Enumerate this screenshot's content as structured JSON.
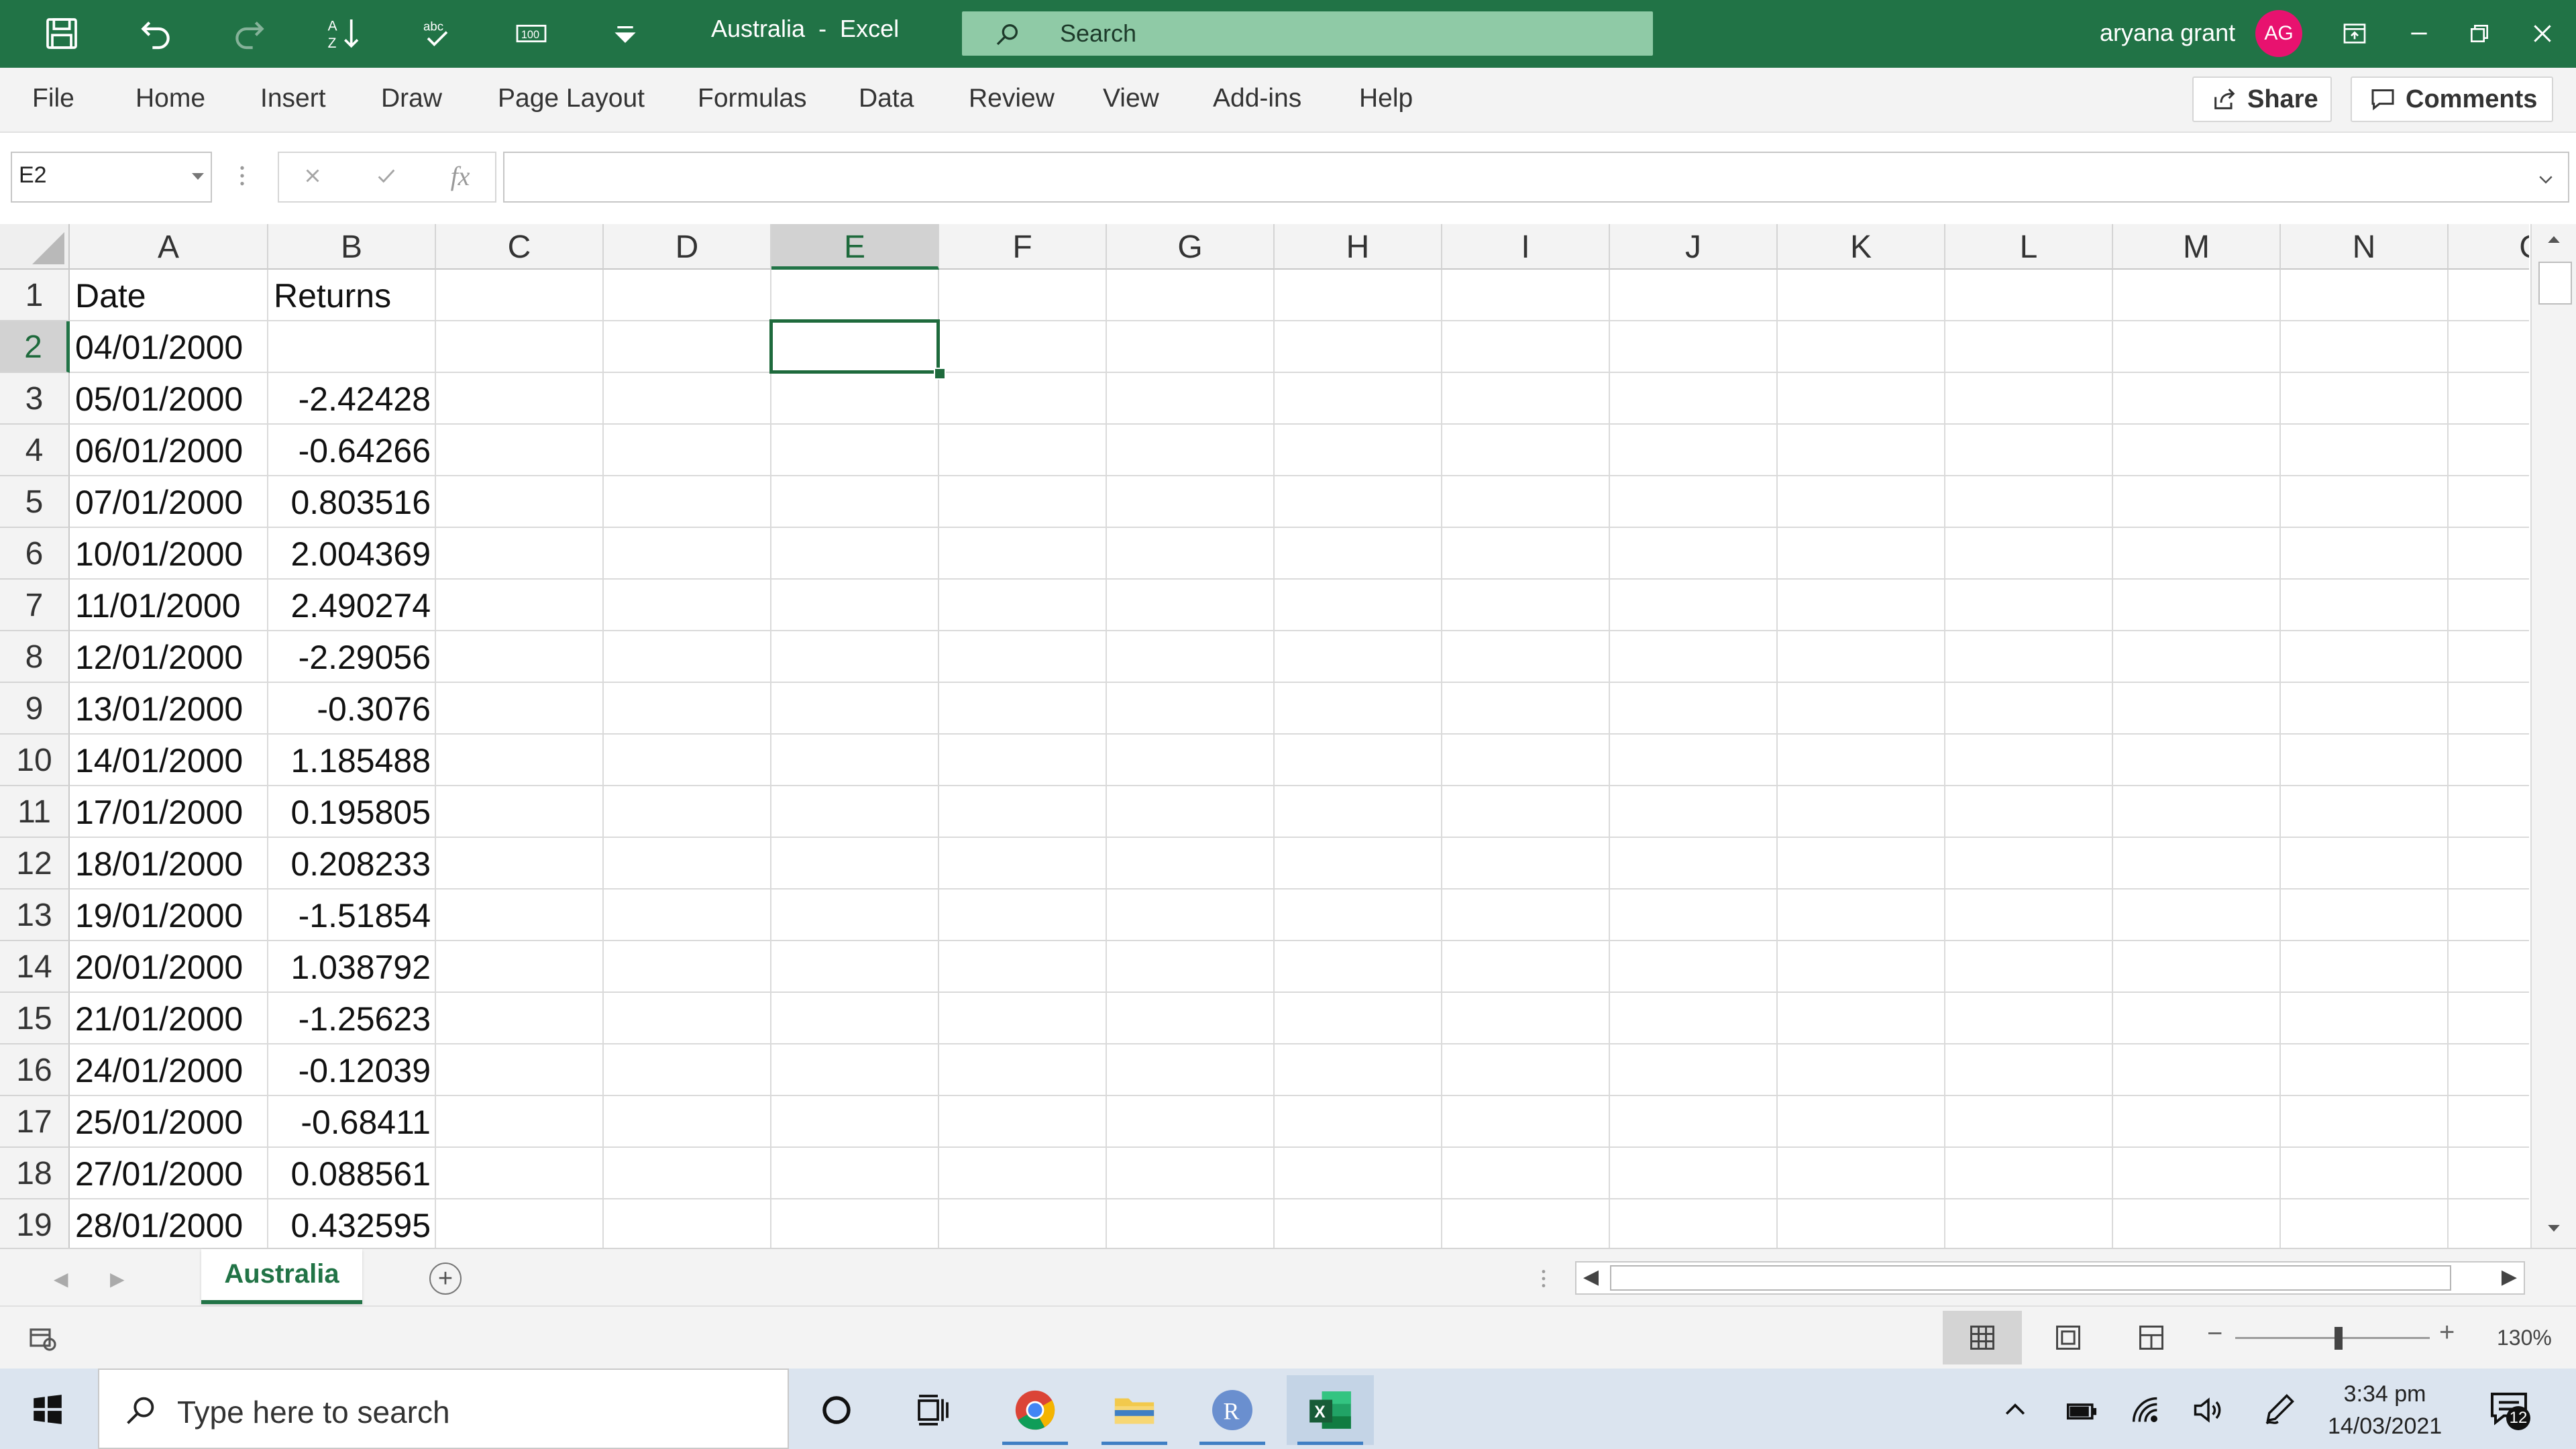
{
  "window": {
    "doc_title": "Australia  -  Excel",
    "search_label": "Search",
    "user_name": "aryana grant",
    "user_initials": "AG"
  },
  "quick_access": {
    "zoom_badge": "100"
  },
  "menu": {
    "items": [
      "File",
      "Home",
      "Insert",
      "Draw",
      "Page Layout",
      "Formulas",
      "Data",
      "Review",
      "View",
      "Add-ins",
      "Help"
    ],
    "share_label": "Share",
    "comments_label": "Comments"
  },
  "formula_bar": {
    "name_box": "E2",
    "formula_value": ""
  },
  "grid": {
    "columns": [
      "A",
      "B",
      "C",
      "D",
      "E",
      "F",
      "G",
      "H",
      "I",
      "J",
      "K",
      "L",
      "M",
      "N",
      "O"
    ],
    "selected_column": "E",
    "selected_row": 2,
    "rows": [
      {
        "num": "1",
        "a": "Date",
        "b": "Returns"
      },
      {
        "num": "2",
        "a": "04/01/2000",
        "b": ""
      },
      {
        "num": "3",
        "a": "05/01/2000",
        "b": "-2.42428"
      },
      {
        "num": "4",
        "a": "06/01/2000",
        "b": "-0.64266"
      },
      {
        "num": "5",
        "a": "07/01/2000",
        "b": "0.803516"
      },
      {
        "num": "6",
        "a": "10/01/2000",
        "b": "2.004369"
      },
      {
        "num": "7",
        "a": "11/01/2000",
        "b": "2.490274"
      },
      {
        "num": "8",
        "a": "12/01/2000",
        "b": "-2.29056"
      },
      {
        "num": "9",
        "a": "13/01/2000",
        "b": "-0.3076"
      },
      {
        "num": "10",
        "a": "14/01/2000",
        "b": "1.185488"
      },
      {
        "num": "11",
        "a": "17/01/2000",
        "b": "0.195805"
      },
      {
        "num": "12",
        "a": "18/01/2000",
        "b": "0.208233"
      },
      {
        "num": "13",
        "a": "19/01/2000",
        "b": "-1.51854"
      },
      {
        "num": "14",
        "a": "20/01/2000",
        "b": "1.038792"
      },
      {
        "num": "15",
        "a": "21/01/2000",
        "b": "-1.25623"
      },
      {
        "num": "16",
        "a": "24/01/2000",
        "b": "-0.12039"
      },
      {
        "num": "17",
        "a": "25/01/2000",
        "b": "-0.68411"
      },
      {
        "num": "18",
        "a": "27/01/2000",
        "b": "0.088561"
      },
      {
        "num": "19",
        "a": "28/01/2000",
        "b": "0.432595"
      }
    ]
  },
  "sheets": {
    "active": "Australia"
  },
  "status": {
    "zoom": "130%",
    "zoom_fraction": 0.53
  },
  "taskbar": {
    "search_placeholder": "Type here to search",
    "time": "3:34 pm",
    "date": "14/03/2021",
    "notification_count": "12"
  },
  "colors": {
    "excel_green": "#217346",
    "avatar": "#e8126f",
    "search_box": "#8fcaa6"
  }
}
